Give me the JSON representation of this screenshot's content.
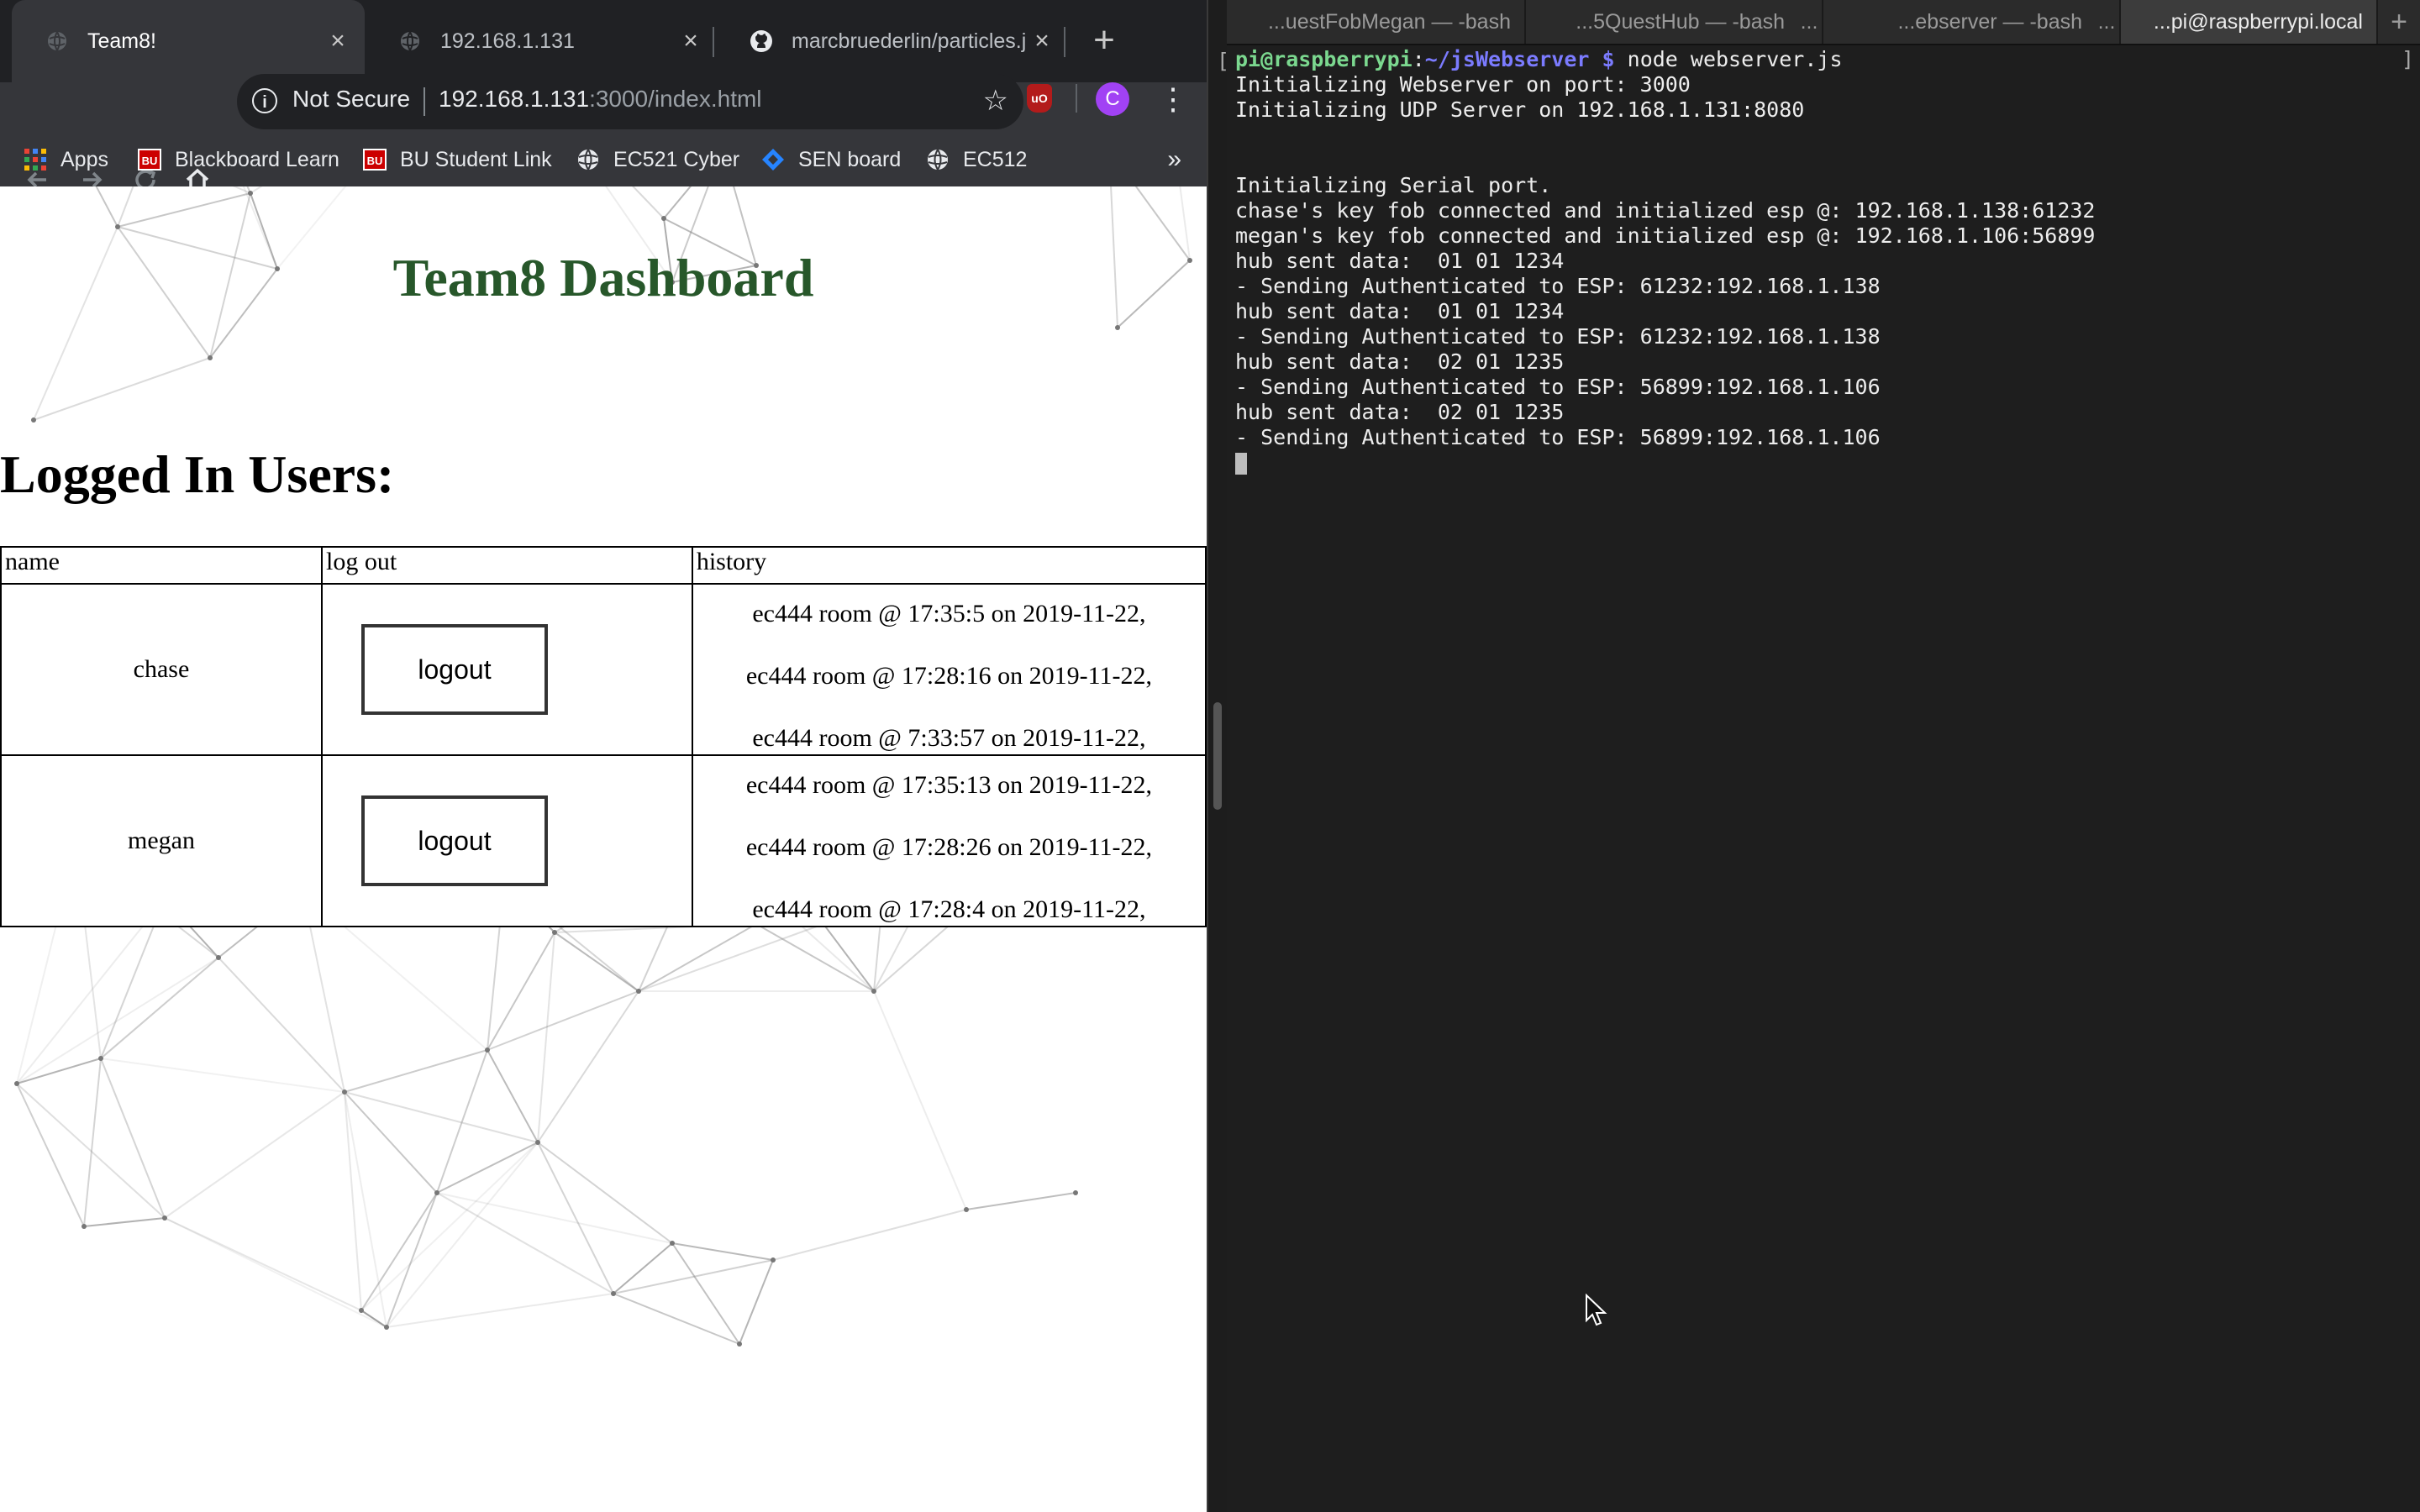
{
  "browser": {
    "tabs": [
      {
        "title": "Team8!",
        "active": true
      },
      {
        "title": "192.168.1.131",
        "active": false
      },
      {
        "title": "marcbruederlin/particles.js",
        "active": false
      }
    ],
    "security_label": "Not Secure",
    "url_host": "192.168.1.131",
    "url_path": ":3000/index.html",
    "profile_initial": "C",
    "ublock_label": "uO",
    "bookmarks": [
      {
        "label": "Apps",
        "icon": "apps-grid-icon"
      },
      {
        "label": "Blackboard Learn",
        "icon": "bu-logo-icon"
      },
      {
        "label": "BU Student Link",
        "icon": "bu-logo-icon"
      },
      {
        "label": "EC521 Cyber",
        "icon": "globe-icon"
      },
      {
        "label": "SEN board",
        "icon": "jira-diamond-icon"
      },
      {
        "label": "EC512",
        "icon": "globe-icon"
      }
    ],
    "bookmarks_more": "»",
    "bu_badge": "BU"
  },
  "page": {
    "title": "Team8 Dashboard",
    "heading": "Logged In Users:",
    "table": {
      "headers": [
        "name",
        "log out",
        "history"
      ],
      "rows": [
        {
          "name": "chase",
          "button": "logout",
          "history": [
            "ec444 room @ 17:35:5 on 2019-11-22,",
            "ec444 room @ 17:28:16 on 2019-11-22,",
            "ec444 room @ 7:33:57 on 2019-11-22,"
          ]
        },
        {
          "name": "megan",
          "button": "logout",
          "history": [
            "ec444 room @ 17:35:13 on 2019-11-22,",
            "ec444 room @ 17:28:26 on 2019-11-22,",
            "ec444 room @ 17:28:4 on 2019-11-22,"
          ]
        }
      ]
    }
  },
  "terminal": {
    "tabs": [
      {
        "title": "...uestFobMegan — -bash",
        "active": false
      },
      {
        "title": "...5QuestHub — -bash",
        "active": false
      },
      {
        "title": "...ebserver — -bash",
        "active": false
      },
      {
        "title": "...pi@raspberrypi.local",
        "active": true
      }
    ],
    "tab_more": "...",
    "prompt_user": "pi@raspberrypi",
    "prompt_sep": ":",
    "prompt_path": "~/jsWebserver",
    "prompt_symbol": "$",
    "command": "node webserver.js",
    "lines": [
      "Initializing Webserver on port: 3000",
      "Initializing UDP Server on 192.168.1.131:8080",
      "",
      "",
      "Initializing Serial port.",
      "chase's key fob connected and initialized esp @: 192.168.1.138:61232",
      "megan's key fob connected and initialized esp @: 192.168.1.106:56899",
      "hub sent data:  01 01 1234",
      "- Sending Authenticated to ESP: 61232:192.168.1.138",
      "hub sent data:  01 01 1234",
      "- Sending Authenticated to ESP: 61232:192.168.1.138",
      "hub sent data:  02 01 1235",
      "- Sending Authenticated to ESP: 56899:192.168.1.106",
      "hub sent data:  02 01 1235",
      "- Sending Authenticated to ESP: 56899:192.168.1.106"
    ]
  }
}
